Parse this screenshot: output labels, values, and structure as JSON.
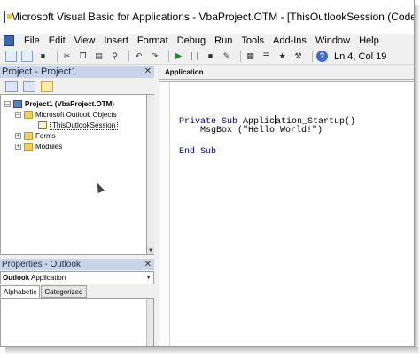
{
  "window": {
    "title": "Microsoft Visual Basic for Applications - VbaProject.OTM - [ThisOutlookSession (Code)]"
  },
  "menu": [
    "File",
    "Edit",
    "View",
    "Insert",
    "Format",
    "Debug",
    "Run",
    "Tools",
    "Add-Ins",
    "Window",
    "Help"
  ],
  "toolbar": {
    "position": "Ln 4, Col 19"
  },
  "project": {
    "title": "Project - Project1",
    "root": "Project1 (VbaProject.OTM)",
    "outlook_objects": "Microsoft Outlook Objects",
    "session": "ThisOutlookSession",
    "forms": "Forms",
    "modules": "Modules"
  },
  "properties": {
    "title": "Properties - Outlook",
    "object_name": "Outlook",
    "object_type": "Application",
    "tab_alpha": "Alphabetic",
    "tab_cat": "Categorized"
  },
  "code": {
    "object_combo": "Application",
    "line1_kw": "Private Sub",
    "line1_a": " Applic",
    "line1_b": "ation_Startup()",
    "line2": "    MsgBox (\"Hello World!\")",
    "line3": "End Sub"
  },
  "colors": {
    "panel_title": "#c9d4e6",
    "keyword": "#00008b"
  }
}
